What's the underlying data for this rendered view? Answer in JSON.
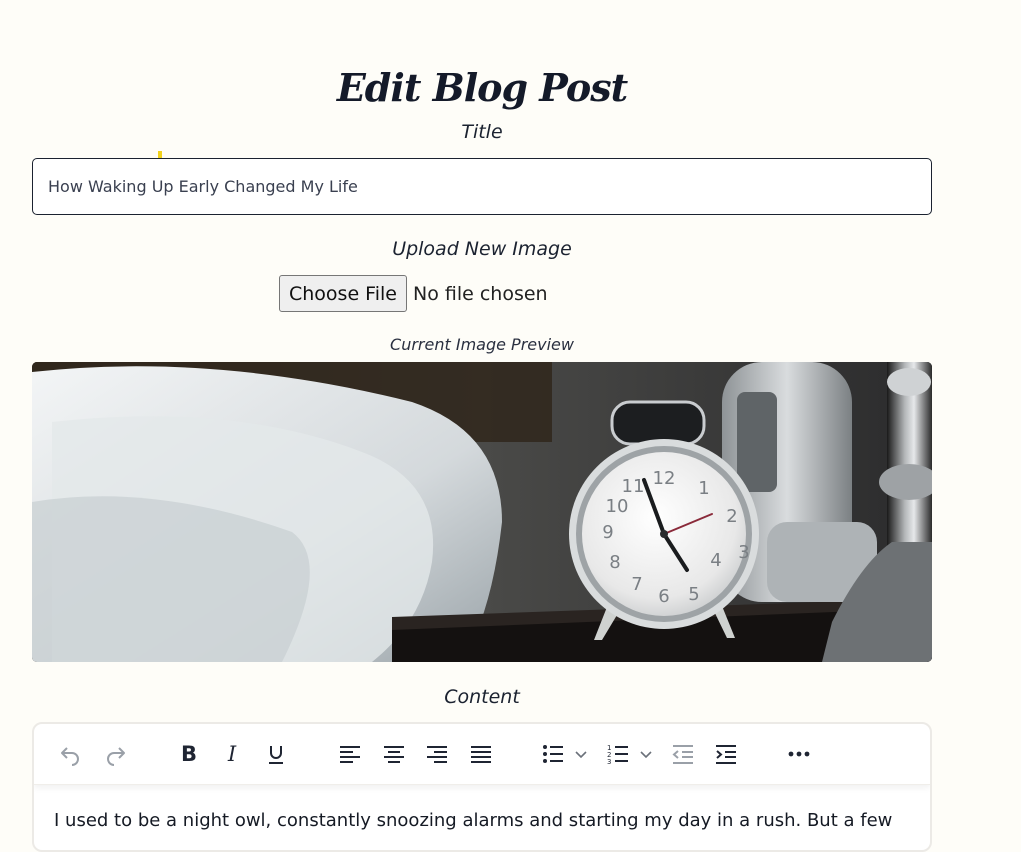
{
  "page": {
    "title": "Edit Blog Post"
  },
  "form": {
    "title_label": "Title",
    "title_value": "How Waking Up Early Changed My Life",
    "upload_label": "Upload New Image",
    "file_button": "Choose File",
    "file_status": "No file chosen",
    "preview_caption": "Current Image Preview",
    "content_label": "Content"
  },
  "editor": {
    "toolbar": [
      {
        "name": "undo-icon"
      },
      {
        "name": "redo-icon"
      },
      {
        "name": "bold-icon"
      },
      {
        "name": "italic-icon"
      },
      {
        "name": "underline-icon"
      },
      {
        "name": "align-left-icon"
      },
      {
        "name": "align-center-icon"
      },
      {
        "name": "align-right-icon"
      },
      {
        "name": "align-justify-icon"
      },
      {
        "name": "bullet-list-icon"
      },
      {
        "name": "numbered-list-icon"
      },
      {
        "name": "outdent-icon"
      },
      {
        "name": "indent-icon"
      },
      {
        "name": "more-icon"
      }
    ],
    "body_text": "I used to be a night owl, constantly snoozing alarms and starting my day in a rush. But a few"
  },
  "colors": {
    "background": "#fefdf8",
    "text": "#1b2230",
    "icon": "#1f2533",
    "icon_disabled": "#9aa0a8",
    "cursor_marker": "#f2d21c"
  }
}
